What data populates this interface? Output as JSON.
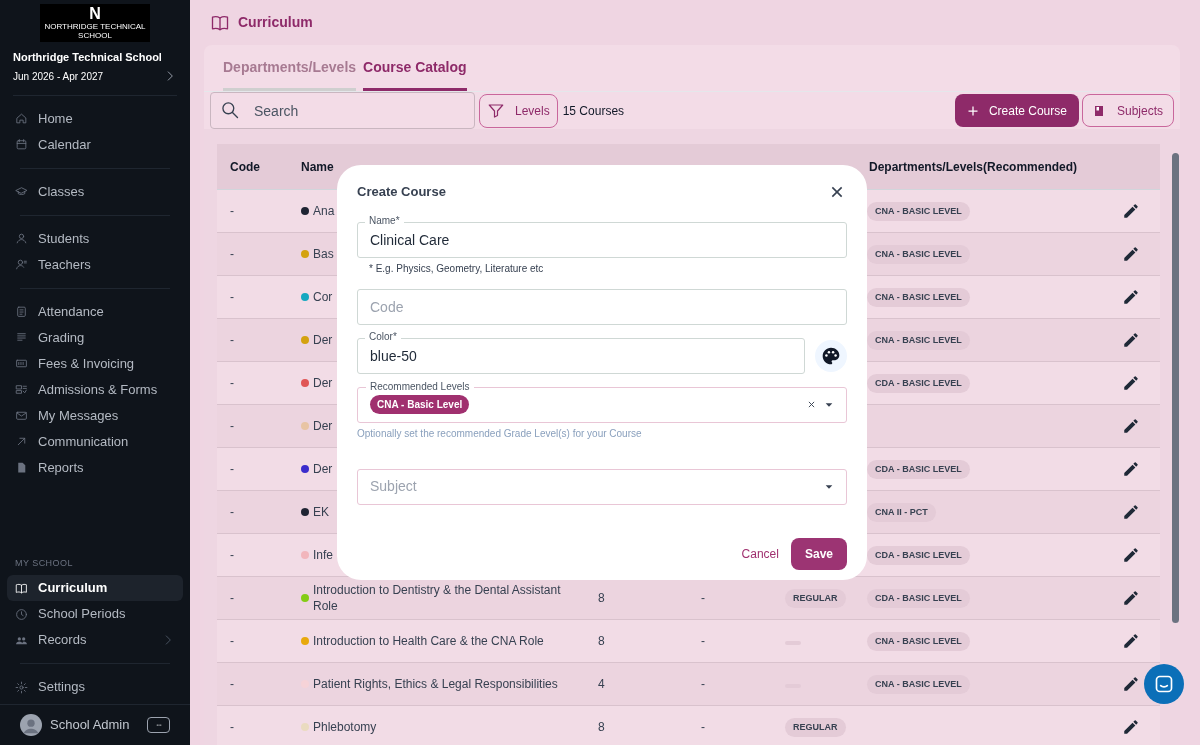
{
  "sidebar": {
    "logo": {
      "mark": "N",
      "caption": "NORTHRIDGE TECHNICAL SCHOOL"
    },
    "school": "Northridge Technical School",
    "period": "Jun 2026 - Apr 2027",
    "groups": [
      [
        {
          "label": "Home",
          "selected": false
        },
        {
          "label": "Calendar",
          "selected": false
        }
      ],
      [
        {
          "label": "Classes",
          "selected": false
        }
      ],
      [
        {
          "label": "Students",
          "selected": false
        },
        {
          "label": "Teachers",
          "selected": false
        }
      ],
      [
        {
          "label": "Attendance",
          "selected": false
        },
        {
          "label": "Grading",
          "selected": false
        },
        {
          "label": "Fees & Invoicing",
          "selected": false
        },
        {
          "label": "Admissions & Forms",
          "selected": false
        },
        {
          "label": "My Messages",
          "selected": false
        },
        {
          "label": "Communication",
          "selected": false
        },
        {
          "label": "Reports",
          "selected": false
        }
      ]
    ],
    "section_title": "MY SCHOOL",
    "school_items": [
      {
        "label": "Curriculum",
        "selected": true,
        "chevron": false
      },
      {
        "label": "School Periods",
        "selected": false,
        "chevron": false
      },
      {
        "label": "Records",
        "selected": false,
        "chevron": true
      }
    ],
    "settings": {
      "label": "Settings",
      "selected": false
    },
    "user": {
      "name": "School Admin"
    }
  },
  "page_title": "Curriculum",
  "tabs": [
    {
      "label": "Departments/Levels",
      "selected": false
    },
    {
      "label": "Course Catalog",
      "selected": true
    }
  ],
  "toolbar": {
    "search": {
      "placeholder": "Search"
    },
    "filter": "Levels",
    "count": "15 Courses",
    "create": "Create Course",
    "subjects": "Subjects"
  },
  "table": {
    "columns": [
      "Code",
      "Name",
      "Departments/Levels(Recommended)"
    ],
    "rows": [
      {
        "code": "-",
        "color": "#1f2433",
        "name": "Ana",
        "dept": "CNA - BASIC LEVEL"
      },
      {
        "code": "-",
        "color": "#d4a20f",
        "name": "Bas",
        "dept": "CNA - BASIC LEVEL"
      },
      {
        "code": "-",
        "color": "#16a8c0",
        "name": "Cor",
        "dept": "CNA - BASIC LEVEL"
      },
      {
        "code": "-",
        "color": "#d4a20f",
        "name": "Der",
        "dept": "CNA - BASIC LEVEL"
      },
      {
        "code": "-",
        "color": "#e05555",
        "name": "Der",
        "dept": "CDA - BASIC LEVEL"
      },
      {
        "code": "-",
        "color": "#e8c4a4",
        "name": "Der"
      },
      {
        "code": "-",
        "color": "#3b2ccc",
        "name": "Der",
        "dept": "CDA - BASIC LEVEL"
      },
      {
        "code": "-",
        "color": "#1f2433",
        "name": "EK",
        "dept": "CNA II - PCT"
      },
      {
        "code": "-",
        "color": "#f2b6bc",
        "name": "Infe",
        "dept": "CDA - BASIC LEVEL"
      },
      {
        "code": "-",
        "color": "#84cc16",
        "name": "Introduction to Dentistry & the Dental Assistant Role",
        "column_3": "8",
        "column_4": "-",
        "column_5": "REGULAR",
        "dept": "CDA - BASIC LEVEL"
      },
      {
        "code": "-",
        "color": "#e8a90c",
        "name": "Introduction to Health Care & the CNA Role",
        "column_3": "8",
        "column_4": "-",
        "column_5_blank": true,
        "dept": "CNA - BASIC LEVEL"
      },
      {
        "code": "-",
        "color": "#f6d3d8",
        "name": "Patient Rights, Ethics & Legal Responsibilities",
        "column_3": "4",
        "column_4": "-",
        "column_5_blank": true,
        "dept": "CNA - BASIC LEVEL"
      },
      {
        "code": "-",
        "color": "#eadbc0",
        "name": "Phlebotomy",
        "column_3": "8",
        "column_4": "-",
        "column_5": "REGULAR"
      }
    ]
  },
  "modal": {
    "title": "Create Course",
    "fields": [
      {
        "kind": "text",
        "label": "Name*",
        "value": "Clinical Care",
        "helper": "* E.g. Physics, Geometry, Literature etc"
      },
      {
        "kind": "text",
        "placeholder": "Code"
      },
      {
        "kind": "color",
        "label": "Color*",
        "value": "blue-50"
      },
      {
        "kind": "multiselect",
        "label": "Recommended Levels",
        "chips": [
          "CNA - Basic Level"
        ],
        "helper": "Optionally set the recommended Grade Level(s) for your Course"
      },
      {
        "kind": "select",
        "placeholder": "Subject"
      }
    ],
    "cancel": "Cancel",
    "save": "Save"
  }
}
